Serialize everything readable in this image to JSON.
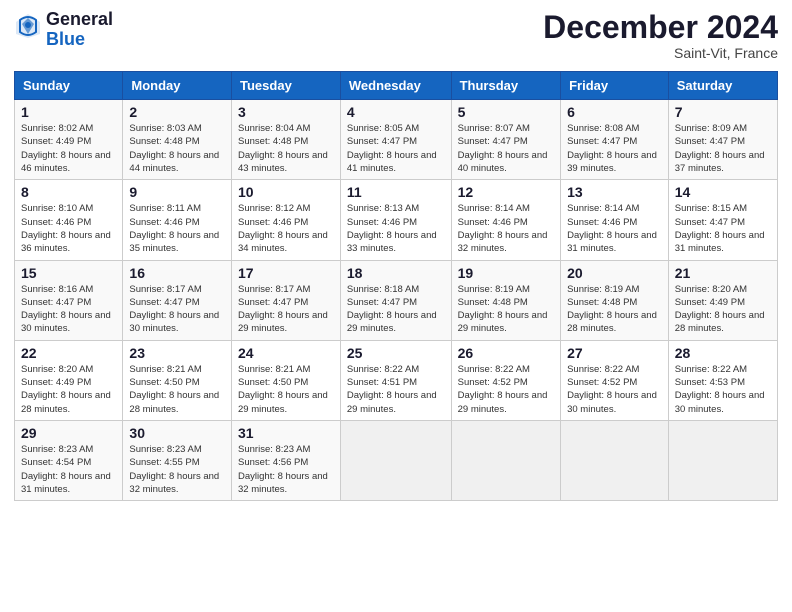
{
  "header": {
    "logo_general": "General",
    "logo_blue": "Blue",
    "title": "December 2024",
    "location": "Saint-Vit, France"
  },
  "days_of_week": [
    "Sunday",
    "Monday",
    "Tuesday",
    "Wednesday",
    "Thursday",
    "Friday",
    "Saturday"
  ],
  "weeks": [
    [
      {
        "num": "1",
        "sunrise": "Sunrise: 8:02 AM",
        "sunset": "Sunset: 4:49 PM",
        "daylight": "Daylight: 8 hours and 46 minutes."
      },
      {
        "num": "2",
        "sunrise": "Sunrise: 8:03 AM",
        "sunset": "Sunset: 4:48 PM",
        "daylight": "Daylight: 8 hours and 44 minutes."
      },
      {
        "num": "3",
        "sunrise": "Sunrise: 8:04 AM",
        "sunset": "Sunset: 4:48 PM",
        "daylight": "Daylight: 8 hours and 43 minutes."
      },
      {
        "num": "4",
        "sunrise": "Sunrise: 8:05 AM",
        "sunset": "Sunset: 4:47 PM",
        "daylight": "Daylight: 8 hours and 41 minutes."
      },
      {
        "num": "5",
        "sunrise": "Sunrise: 8:07 AM",
        "sunset": "Sunset: 4:47 PM",
        "daylight": "Daylight: 8 hours and 40 minutes."
      },
      {
        "num": "6",
        "sunrise": "Sunrise: 8:08 AM",
        "sunset": "Sunset: 4:47 PM",
        "daylight": "Daylight: 8 hours and 39 minutes."
      },
      {
        "num": "7",
        "sunrise": "Sunrise: 8:09 AM",
        "sunset": "Sunset: 4:47 PM",
        "daylight": "Daylight: 8 hours and 37 minutes."
      }
    ],
    [
      {
        "num": "8",
        "sunrise": "Sunrise: 8:10 AM",
        "sunset": "Sunset: 4:46 PM",
        "daylight": "Daylight: 8 hours and 36 minutes."
      },
      {
        "num": "9",
        "sunrise": "Sunrise: 8:11 AM",
        "sunset": "Sunset: 4:46 PM",
        "daylight": "Daylight: 8 hours and 35 minutes."
      },
      {
        "num": "10",
        "sunrise": "Sunrise: 8:12 AM",
        "sunset": "Sunset: 4:46 PM",
        "daylight": "Daylight: 8 hours and 34 minutes."
      },
      {
        "num": "11",
        "sunrise": "Sunrise: 8:13 AM",
        "sunset": "Sunset: 4:46 PM",
        "daylight": "Daylight: 8 hours and 33 minutes."
      },
      {
        "num": "12",
        "sunrise": "Sunrise: 8:14 AM",
        "sunset": "Sunset: 4:46 PM",
        "daylight": "Daylight: 8 hours and 32 minutes."
      },
      {
        "num": "13",
        "sunrise": "Sunrise: 8:14 AM",
        "sunset": "Sunset: 4:46 PM",
        "daylight": "Daylight: 8 hours and 31 minutes."
      },
      {
        "num": "14",
        "sunrise": "Sunrise: 8:15 AM",
        "sunset": "Sunset: 4:47 PM",
        "daylight": "Daylight: 8 hours and 31 minutes."
      }
    ],
    [
      {
        "num": "15",
        "sunrise": "Sunrise: 8:16 AM",
        "sunset": "Sunset: 4:47 PM",
        "daylight": "Daylight: 8 hours and 30 minutes."
      },
      {
        "num": "16",
        "sunrise": "Sunrise: 8:17 AM",
        "sunset": "Sunset: 4:47 PM",
        "daylight": "Daylight: 8 hours and 30 minutes."
      },
      {
        "num": "17",
        "sunrise": "Sunrise: 8:17 AM",
        "sunset": "Sunset: 4:47 PM",
        "daylight": "Daylight: 8 hours and 29 minutes."
      },
      {
        "num": "18",
        "sunrise": "Sunrise: 8:18 AM",
        "sunset": "Sunset: 4:47 PM",
        "daylight": "Daylight: 8 hours and 29 minutes."
      },
      {
        "num": "19",
        "sunrise": "Sunrise: 8:19 AM",
        "sunset": "Sunset: 4:48 PM",
        "daylight": "Daylight: 8 hours and 29 minutes."
      },
      {
        "num": "20",
        "sunrise": "Sunrise: 8:19 AM",
        "sunset": "Sunset: 4:48 PM",
        "daylight": "Daylight: 8 hours and 28 minutes."
      },
      {
        "num": "21",
        "sunrise": "Sunrise: 8:20 AM",
        "sunset": "Sunset: 4:49 PM",
        "daylight": "Daylight: 8 hours and 28 minutes."
      }
    ],
    [
      {
        "num": "22",
        "sunrise": "Sunrise: 8:20 AM",
        "sunset": "Sunset: 4:49 PM",
        "daylight": "Daylight: 8 hours and 28 minutes."
      },
      {
        "num": "23",
        "sunrise": "Sunrise: 8:21 AM",
        "sunset": "Sunset: 4:50 PM",
        "daylight": "Daylight: 8 hours and 28 minutes."
      },
      {
        "num": "24",
        "sunrise": "Sunrise: 8:21 AM",
        "sunset": "Sunset: 4:50 PM",
        "daylight": "Daylight: 8 hours and 29 minutes."
      },
      {
        "num": "25",
        "sunrise": "Sunrise: 8:22 AM",
        "sunset": "Sunset: 4:51 PM",
        "daylight": "Daylight: 8 hours and 29 minutes."
      },
      {
        "num": "26",
        "sunrise": "Sunrise: 8:22 AM",
        "sunset": "Sunset: 4:52 PM",
        "daylight": "Daylight: 8 hours and 29 minutes."
      },
      {
        "num": "27",
        "sunrise": "Sunrise: 8:22 AM",
        "sunset": "Sunset: 4:52 PM",
        "daylight": "Daylight: 8 hours and 30 minutes."
      },
      {
        "num": "28",
        "sunrise": "Sunrise: 8:22 AM",
        "sunset": "Sunset: 4:53 PM",
        "daylight": "Daylight: 8 hours and 30 minutes."
      }
    ],
    [
      {
        "num": "29",
        "sunrise": "Sunrise: 8:23 AM",
        "sunset": "Sunset: 4:54 PM",
        "daylight": "Daylight: 8 hours and 31 minutes."
      },
      {
        "num": "30",
        "sunrise": "Sunrise: 8:23 AM",
        "sunset": "Sunset: 4:55 PM",
        "daylight": "Daylight: 8 hours and 32 minutes."
      },
      {
        "num": "31",
        "sunrise": "Sunrise: 8:23 AM",
        "sunset": "Sunset: 4:56 PM",
        "daylight": "Daylight: 8 hours and 32 minutes."
      },
      {
        "num": "",
        "sunrise": "",
        "sunset": "",
        "daylight": ""
      },
      {
        "num": "",
        "sunrise": "",
        "sunset": "",
        "daylight": ""
      },
      {
        "num": "",
        "sunrise": "",
        "sunset": "",
        "daylight": ""
      },
      {
        "num": "",
        "sunrise": "",
        "sunset": "",
        "daylight": ""
      }
    ]
  ]
}
